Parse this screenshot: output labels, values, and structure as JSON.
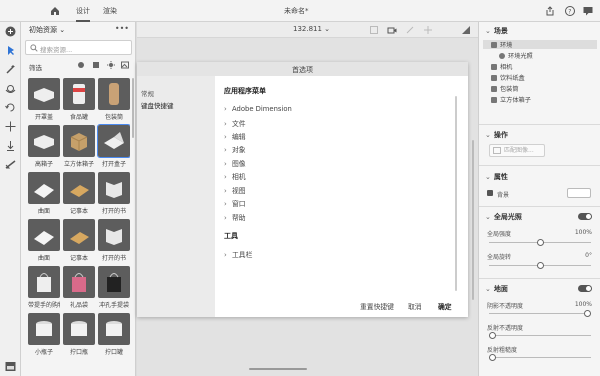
{
  "topbar": {
    "tabs": [
      "设计",
      "渲染"
    ],
    "document_title": "未命名*"
  },
  "assets": {
    "title": "初始资源",
    "more": "•••",
    "search_placeholder": "搜索资源...",
    "filter_label": "筛选",
    "items": [
      {
        "label": "开罩盖"
      },
      {
        "label": "食品罐"
      },
      {
        "label": "包装筒"
      },
      {
        "label": "高箱子"
      },
      {
        "label": "立方体箱子"
      },
      {
        "label": "打开盒子"
      },
      {
        "label": "曲面"
      },
      {
        "label": "记事本"
      },
      {
        "label": "打开的书"
      },
      {
        "label": "曲面"
      },
      {
        "label": "记事本"
      },
      {
        "label": "打开的书"
      },
      {
        "label": "带提手的购物袋"
      },
      {
        "label": "礼品袋"
      },
      {
        "label": "冲孔手提袋"
      },
      {
        "label": "小瓶子"
      },
      {
        "label": "拧口瓶"
      },
      {
        "label": "拧口罐"
      }
    ]
  },
  "canvas": {
    "zoom": "132.811"
  },
  "dialog": {
    "title": "首选项",
    "nav": [
      "常规",
      "键盘快捷键"
    ],
    "section_app_menu": "应用程序菜单",
    "menu_items": [
      "Adobe Dimension",
      "文件",
      "编辑",
      "对象",
      "图像",
      "相机",
      "视图",
      "窗口",
      "帮助"
    ],
    "section_tools": "工具",
    "tool_items": [
      "工具栏"
    ],
    "buttons": {
      "reset": "重置快捷键",
      "cancel": "取消",
      "ok": "确定"
    }
  },
  "properties": {
    "scene_header": "场景",
    "scene_tree": [
      {
        "label": "环境"
      },
      {
        "label": "环境光照"
      },
      {
        "label": "相机"
      },
      {
        "label": "饮料纸盒"
      },
      {
        "label": "包装筒"
      },
      {
        "label": "立方体箱子"
      }
    ],
    "actions_header": "操作",
    "match_image": "匹配图像...",
    "attributes_header": "属性",
    "background_label": "背景",
    "global_light_header": "全局光照",
    "global_intensity_label": "全局强度",
    "global_intensity_value": "100%",
    "global_rotation_label": "全局旋转",
    "global_rotation_value": "0°",
    "ground_header": "地面",
    "shadow_opacity_label": "阴影不透明度",
    "shadow_opacity_value": "100%",
    "reflection_opacity_label": "反射不透明度",
    "reflection_roughness_label": "反射粗糙度",
    "levels": {
      "global_intensity": 0.5,
      "global_rotation": 0.5,
      "shadow_opacity": 1.0,
      "reflection_opacity": 0.0,
      "reflection_roughness": 0.0
    }
  },
  "icons": [
    "plus-icon",
    "select-icon",
    "magic-wand-icon",
    "orbit-icon",
    "pan-icon",
    "move-icon",
    "home-icon",
    "share-icon",
    "help-icon",
    "chat-icon"
  ]
}
